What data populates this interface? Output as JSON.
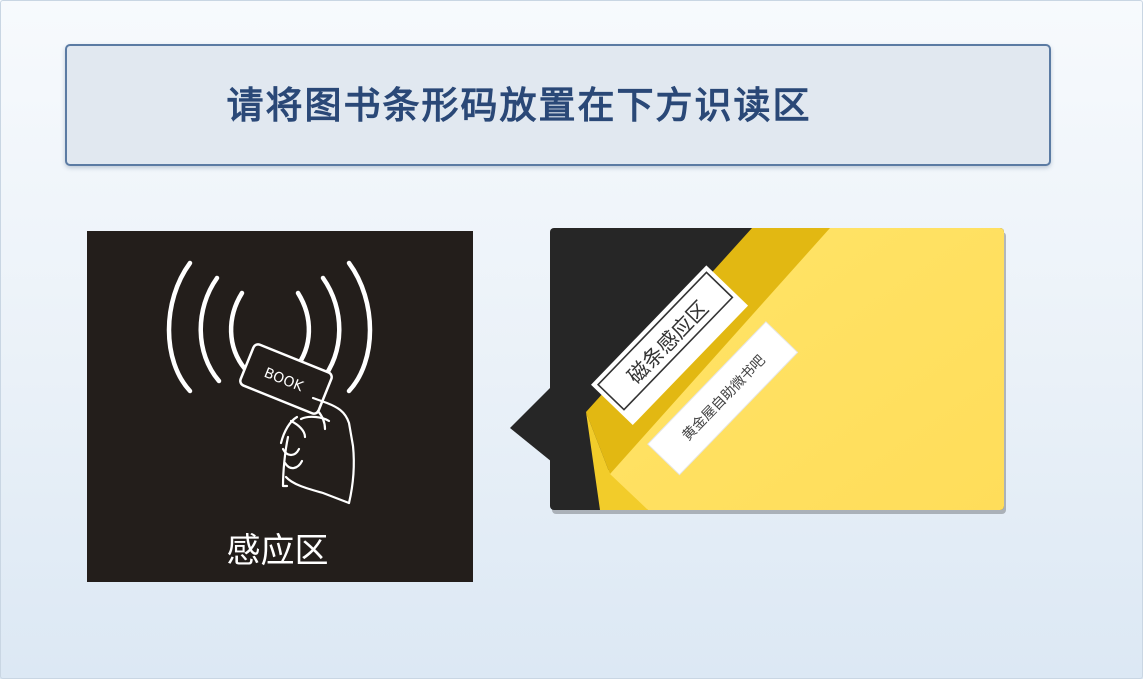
{
  "banner": {
    "text": "请将图书条形码放置在下方识读区"
  },
  "sensor": {
    "label": "感应区",
    "card_text": "BOOK"
  },
  "callout": {
    "strip_title": "磁条感应区",
    "strip_subtitle": "黄金屋自助微书吧"
  },
  "colors": {
    "banner_bg": "#e1e8f0",
    "banner_border": "#5b7ba3",
    "banner_text": "#2a4877",
    "panel_dark": "#231e1b",
    "book_yellow": "#ffe066",
    "book_spine": "#e6bb10"
  },
  "icons": [
    "rfid-waves-icon",
    "hand-holding-card-icon"
  ]
}
